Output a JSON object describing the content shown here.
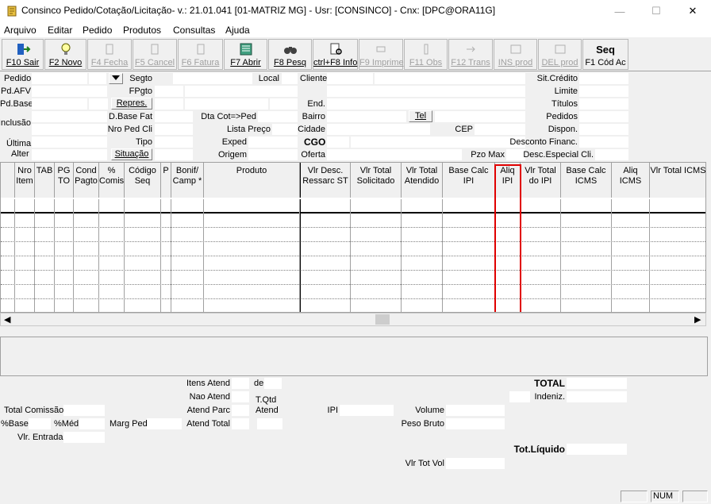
{
  "window": {
    "title": "Consinco Pedido/Cotação/Licitação- v.: 21.01.041  [01-MATRIZ MG]  - Usr: [CONSINCO] - Cnx: [DPC@ORA11G]",
    "minimize": "—",
    "maximize": "☐",
    "close": "✕"
  },
  "menu": [
    "Arquivo",
    "Editar",
    "Pedido",
    "Produtos",
    "Consultas",
    "Ajuda"
  ],
  "toolbar": [
    {
      "label": "F10 Sair",
      "icon": "exit-icon",
      "enabled": true
    },
    {
      "label": "F2 Novo",
      "icon": "lightbulb-icon",
      "enabled": true
    },
    {
      "label": "F4 Fecha",
      "icon": "close-doc-icon",
      "enabled": false
    },
    {
      "label": "F5 Cancel",
      "icon": "cancel-icon",
      "enabled": false
    },
    {
      "label": "F6 Fatura",
      "icon": "invoice-icon",
      "enabled": false
    },
    {
      "label": "F7 Abrir",
      "icon": "open-icon",
      "enabled": true
    },
    {
      "label": "F8 Pesq",
      "icon": "binoculars-icon",
      "enabled": true
    },
    {
      "label": "ctrl+F8 Info",
      "icon": "info-icon",
      "enabled": true
    },
    {
      "label": "F9 Imprime",
      "icon": "print-icon",
      "enabled": false
    },
    {
      "label": "F11 Obs",
      "icon": "notes-icon",
      "enabled": false
    },
    {
      "label": "F12 Trans",
      "icon": "transfer-icon",
      "enabled": false
    },
    {
      "label": "INS prod",
      "icon": "insert-icon",
      "enabled": false
    },
    {
      "label": "DEL prod",
      "icon": "delete-icon",
      "enabled": false
    },
    {
      "label": "F1 Cód Ac",
      "seq": "Seq",
      "enabled": true
    }
  ],
  "form": {
    "pedido": "Pedido",
    "segto": "Segto",
    "local": "Local",
    "cliente": "Cliente",
    "sit_credito": "Sit.Crédito",
    "pd_afv": "Pd.AFV",
    "fpgto": "FPgto",
    "limite": "Limite",
    "pd_base": "Pd.Base",
    "repres": "Repres.",
    "end": "End.",
    "titulos": "Títulos",
    "inclusao": "Inclusão",
    "d_base_fat": "D.Base Fat",
    "dta_cot_ped": "Dta Cot=>Ped",
    "bairro": "Bairro",
    "tel": "Tel",
    "pedidos": "Pedidos",
    "nro_ped_cli": "Nro Ped Cli",
    "lista_preco": "Lista Preço",
    "cidade": "Cidade",
    "cep": "CEP",
    "dispon": "Dispon.",
    "ultima": "Última",
    "tipo": "Tipo",
    "exped": "Exped",
    "cgo": "CGO",
    "desconto_financ": "Desconto Financ.",
    "alter": "Alter",
    "situacao": "Situação",
    "origem": "Origem",
    "oferta": "Oferta",
    "pzo_max": "Pzo Max",
    "desc_especial_cli": "Desc.Especial Cli."
  },
  "grid": {
    "columns": [
      "Nro Item",
      "TAB",
      "PG TO",
      "Cond Pagto",
      "% Comis",
      "Código Seq",
      "P",
      "Bonif/ Camp *",
      "Produto",
      "Vlr Desc. Ressarc ST",
      "Vlr Total Solicitado",
      "Vlr Total Atendido",
      "Base Calc IPI",
      "Aliq IPI",
      "Vlr Total do IPI",
      "Base Calc ICMS",
      "Aliq ICMS",
      "Vlr Total ICMS"
    ],
    "row_count": 8,
    "highlight_column": "Aliq IPI",
    "highlight_color": "#e00000"
  },
  "totals": {
    "itens_atend": "Itens Atend",
    "de": "de",
    "nao_atend": "Nao Atend",
    "t_qtd_atend": "T.Qtd Atend",
    "atend_parc": "Atend Parc",
    "atend_total": "Atend Total",
    "total_comissao": "Total Comissão",
    "pct_base": "%Base",
    "pct_med": "%Méd.",
    "marg_ped": "Marg Ped",
    "vlr_entrada": "Vlr. Entrada",
    "ipi": "IPI",
    "volume": "Volume",
    "peso_bruto": "Peso Bruto",
    "vlr_tot_vol": "Vlr Tot Vol",
    "total": "TOTAL",
    "indeniz": "Indeniz.",
    "tot_liquido": "Tot.Líquido"
  },
  "status": {
    "num": "NUM"
  }
}
